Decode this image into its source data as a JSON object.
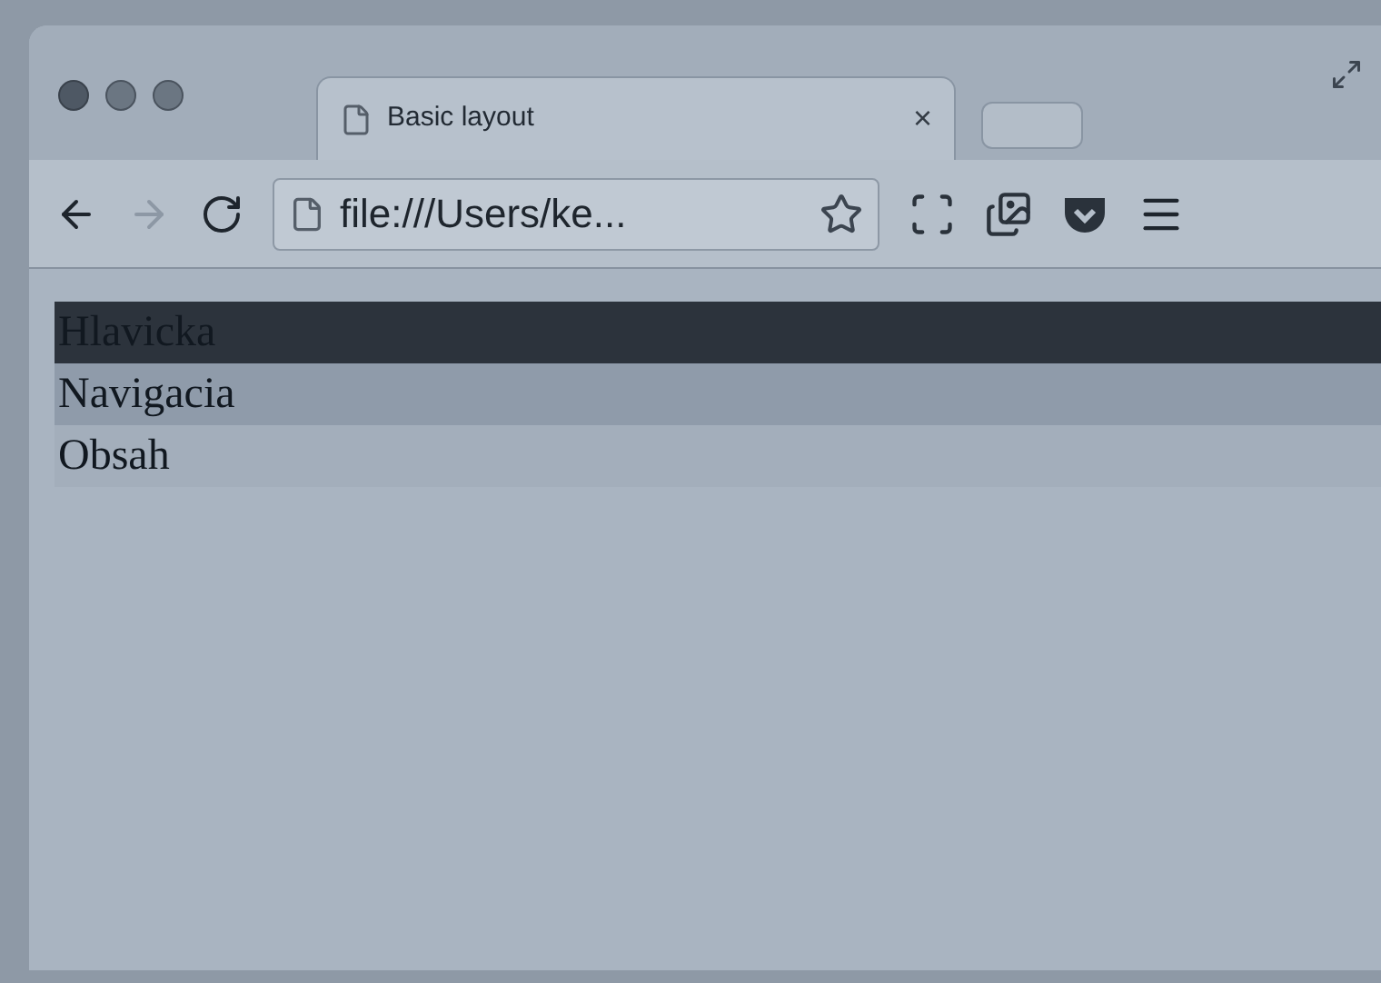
{
  "tab": {
    "title": "Basic layout",
    "close": "×"
  },
  "address_bar": {
    "value": "file:///Users/ke..."
  },
  "sections": [
    {
      "label": "Hlavicka",
      "color": "#2c333c"
    },
    {
      "label": "Navigacia",
      "color": "#8f9baa"
    },
    {
      "label": "Obsah",
      "color": "#a3aebb"
    }
  ]
}
